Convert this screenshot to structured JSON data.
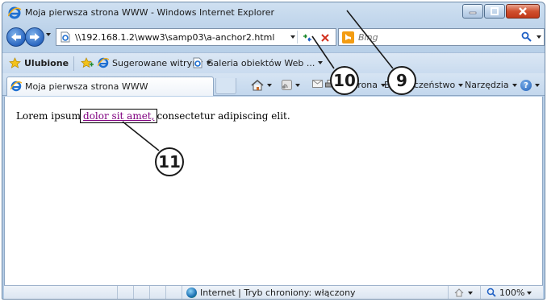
{
  "window": {
    "title": "Moja pierwsza strona WWW - Windows Internet Explorer",
    "controls": [
      "minimize-icon",
      "maximize-icon",
      "close-icon"
    ]
  },
  "navigation": {
    "address_url": "\\\\192.168.1.2\\www3\\samp03\\a-anchor2.html",
    "search_placeholder": "Bing"
  },
  "favorites_bar": {
    "ulubione": "Ulubione",
    "sugerowane": "Sugerowane witryny",
    "galeria": "Galeria obiektów Web ..."
  },
  "tab": {
    "label": "Moja pierwsza strona WWW"
  },
  "command_bar": {
    "strona": "Strona",
    "bezpieczenstwo": "Bezpieczeństwo",
    "narzedzia": "Narzędzia"
  },
  "page": {
    "text_before": "Lorem ipsum",
    "link_text": "dolor sit amet,",
    "text_after": "consectetur adipiscing elit."
  },
  "status_bar": {
    "zone": "Internet | Tryb chroniony: włączony",
    "zoom": "100%"
  },
  "callouts": [
    "9",
    "10",
    "11"
  ],
  "colors": {
    "link_visited": "#800080",
    "chrome_blue": "#b9d0e8",
    "close_red": "#d0502f"
  }
}
